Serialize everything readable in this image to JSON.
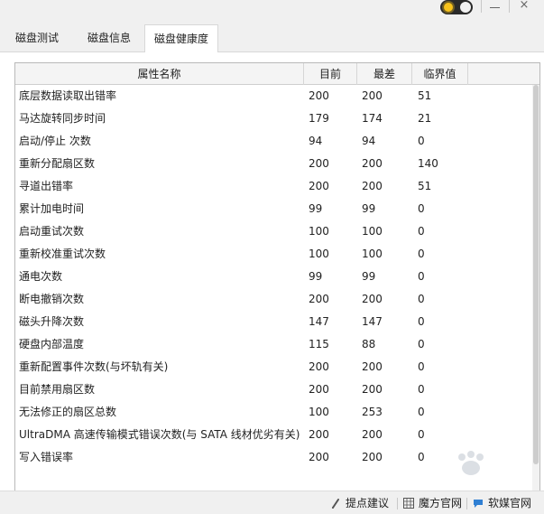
{
  "titlebar": {
    "theme_toggle_icon": "sun-icon",
    "minimize_icon": "minimize-icon",
    "close_icon": "close-icon",
    "close_glyph": "×"
  },
  "tabs": [
    {
      "label": "磁盘测试"
    },
    {
      "label": "磁盘信息"
    },
    {
      "label": "磁盘健康度",
      "active": true
    }
  ],
  "table": {
    "headers": [
      "属性名称",
      "目前",
      "最差",
      "临界值"
    ],
    "rows": [
      [
        "底层数据读取出错率",
        "200",
        "200",
        "51"
      ],
      [
        "马达旋转同步时间",
        "179",
        "174",
        "21"
      ],
      [
        "启动/停止 次数",
        "94",
        "94",
        "0"
      ],
      [
        "重新分配扇区数",
        "200",
        "200",
        "140"
      ],
      [
        "寻道出错率",
        "200",
        "200",
        "51"
      ],
      [
        "累计加电时间",
        "99",
        "99",
        "0"
      ],
      [
        "启动重试次数",
        "100",
        "100",
        "0"
      ],
      [
        "重新校准重试次数",
        "100",
        "100",
        "0"
      ],
      [
        "通电次数",
        "99",
        "99",
        "0"
      ],
      [
        "断电撤销次数",
        "200",
        "200",
        "0"
      ],
      [
        "磁头升降次数",
        "147",
        "147",
        "0"
      ],
      [
        "硬盘内部温度",
        "115",
        "88",
        "0"
      ],
      [
        "重新配置事件次数(与坏轨有关)",
        "200",
        "200",
        "0"
      ],
      [
        "目前禁用扇区数",
        "200",
        "200",
        "0"
      ],
      [
        "无法修正的扇区总数",
        "100",
        "253",
        "0"
      ],
      [
        "UltraDMA 高速传输模式错误次数(与 SATA 线材优劣有关)",
        "200",
        "200",
        "0"
      ],
      [
        "写入错误率",
        "200",
        "200",
        "0"
      ]
    ]
  },
  "footer": {
    "items": [
      {
        "label": "提点建议",
        "icon": "feedback-icon"
      },
      {
        "label": "魔方官网",
        "icon": "grid-icon"
      },
      {
        "label": "软媒官网",
        "icon": "chat-icon"
      }
    ]
  },
  "colors": {
    "accent_toggle": "#f7c21b",
    "footer_icon_blue": "#2f7fd3"
  }
}
